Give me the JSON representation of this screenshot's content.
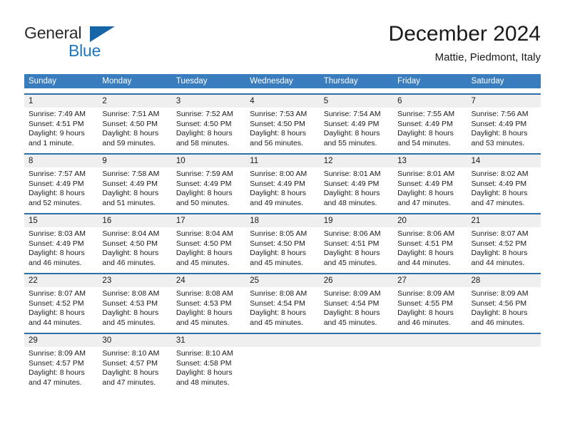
{
  "brand": {
    "line1": "General",
    "line2": "Blue",
    "triangle_color": "#1565a8",
    "blue_color": "#1f76bd"
  },
  "header": {
    "title": "December 2024",
    "subtitle": "Mattie, Piedmont, Italy"
  },
  "theme": {
    "header_row_bg": "#3a7dbf",
    "week_rule": "#2f6fa8",
    "daynum_bg": "#efefef"
  },
  "calendar": {
    "day_headers": [
      "Sunday",
      "Monday",
      "Tuesday",
      "Wednesday",
      "Thursday",
      "Friday",
      "Saturday"
    ],
    "weeks": [
      [
        {
          "day": "1",
          "sunrise": "Sunrise: 7:49 AM",
          "sunset": "Sunset: 4:51 PM",
          "daylight1": "Daylight: 9 hours",
          "daylight2": "and 1 minute."
        },
        {
          "day": "2",
          "sunrise": "Sunrise: 7:51 AM",
          "sunset": "Sunset: 4:50 PM",
          "daylight1": "Daylight: 8 hours",
          "daylight2": "and 59 minutes."
        },
        {
          "day": "3",
          "sunrise": "Sunrise: 7:52 AM",
          "sunset": "Sunset: 4:50 PM",
          "daylight1": "Daylight: 8 hours",
          "daylight2": "and 58 minutes."
        },
        {
          "day": "4",
          "sunrise": "Sunrise: 7:53 AM",
          "sunset": "Sunset: 4:50 PM",
          "daylight1": "Daylight: 8 hours",
          "daylight2": "and 56 minutes."
        },
        {
          "day": "5",
          "sunrise": "Sunrise: 7:54 AM",
          "sunset": "Sunset: 4:49 PM",
          "daylight1": "Daylight: 8 hours",
          "daylight2": "and 55 minutes."
        },
        {
          "day": "6",
          "sunrise": "Sunrise: 7:55 AM",
          "sunset": "Sunset: 4:49 PM",
          "daylight1": "Daylight: 8 hours",
          "daylight2": "and 54 minutes."
        },
        {
          "day": "7",
          "sunrise": "Sunrise: 7:56 AM",
          "sunset": "Sunset: 4:49 PM",
          "daylight1": "Daylight: 8 hours",
          "daylight2": "and 53 minutes."
        }
      ],
      [
        {
          "day": "8",
          "sunrise": "Sunrise: 7:57 AM",
          "sunset": "Sunset: 4:49 PM",
          "daylight1": "Daylight: 8 hours",
          "daylight2": "and 52 minutes."
        },
        {
          "day": "9",
          "sunrise": "Sunrise: 7:58 AM",
          "sunset": "Sunset: 4:49 PM",
          "daylight1": "Daylight: 8 hours",
          "daylight2": "and 51 minutes."
        },
        {
          "day": "10",
          "sunrise": "Sunrise: 7:59 AM",
          "sunset": "Sunset: 4:49 PM",
          "daylight1": "Daylight: 8 hours",
          "daylight2": "and 50 minutes."
        },
        {
          "day": "11",
          "sunrise": "Sunrise: 8:00 AM",
          "sunset": "Sunset: 4:49 PM",
          "daylight1": "Daylight: 8 hours",
          "daylight2": "and 49 minutes."
        },
        {
          "day": "12",
          "sunrise": "Sunrise: 8:01 AM",
          "sunset": "Sunset: 4:49 PM",
          "daylight1": "Daylight: 8 hours",
          "daylight2": "and 48 minutes."
        },
        {
          "day": "13",
          "sunrise": "Sunrise: 8:01 AM",
          "sunset": "Sunset: 4:49 PM",
          "daylight1": "Daylight: 8 hours",
          "daylight2": "and 47 minutes."
        },
        {
          "day": "14",
          "sunrise": "Sunrise: 8:02 AM",
          "sunset": "Sunset: 4:49 PM",
          "daylight1": "Daylight: 8 hours",
          "daylight2": "and 47 minutes."
        }
      ],
      [
        {
          "day": "15",
          "sunrise": "Sunrise: 8:03 AM",
          "sunset": "Sunset: 4:49 PM",
          "daylight1": "Daylight: 8 hours",
          "daylight2": "and 46 minutes."
        },
        {
          "day": "16",
          "sunrise": "Sunrise: 8:04 AM",
          "sunset": "Sunset: 4:50 PM",
          "daylight1": "Daylight: 8 hours",
          "daylight2": "and 46 minutes."
        },
        {
          "day": "17",
          "sunrise": "Sunrise: 8:04 AM",
          "sunset": "Sunset: 4:50 PM",
          "daylight1": "Daylight: 8 hours",
          "daylight2": "and 45 minutes."
        },
        {
          "day": "18",
          "sunrise": "Sunrise: 8:05 AM",
          "sunset": "Sunset: 4:50 PM",
          "daylight1": "Daylight: 8 hours",
          "daylight2": "and 45 minutes."
        },
        {
          "day": "19",
          "sunrise": "Sunrise: 8:06 AM",
          "sunset": "Sunset: 4:51 PM",
          "daylight1": "Daylight: 8 hours",
          "daylight2": "and 45 minutes."
        },
        {
          "day": "20",
          "sunrise": "Sunrise: 8:06 AM",
          "sunset": "Sunset: 4:51 PM",
          "daylight1": "Daylight: 8 hours",
          "daylight2": "and 44 minutes."
        },
        {
          "day": "21",
          "sunrise": "Sunrise: 8:07 AM",
          "sunset": "Sunset: 4:52 PM",
          "daylight1": "Daylight: 8 hours",
          "daylight2": "and 44 minutes."
        }
      ],
      [
        {
          "day": "22",
          "sunrise": "Sunrise: 8:07 AM",
          "sunset": "Sunset: 4:52 PM",
          "daylight1": "Daylight: 8 hours",
          "daylight2": "and 44 minutes."
        },
        {
          "day": "23",
          "sunrise": "Sunrise: 8:08 AM",
          "sunset": "Sunset: 4:53 PM",
          "daylight1": "Daylight: 8 hours",
          "daylight2": "and 45 minutes."
        },
        {
          "day": "24",
          "sunrise": "Sunrise: 8:08 AM",
          "sunset": "Sunset: 4:53 PM",
          "daylight1": "Daylight: 8 hours",
          "daylight2": "and 45 minutes."
        },
        {
          "day": "25",
          "sunrise": "Sunrise: 8:08 AM",
          "sunset": "Sunset: 4:54 PM",
          "daylight1": "Daylight: 8 hours",
          "daylight2": "and 45 minutes."
        },
        {
          "day": "26",
          "sunrise": "Sunrise: 8:09 AM",
          "sunset": "Sunset: 4:54 PM",
          "daylight1": "Daylight: 8 hours",
          "daylight2": "and 45 minutes."
        },
        {
          "day": "27",
          "sunrise": "Sunrise: 8:09 AM",
          "sunset": "Sunset: 4:55 PM",
          "daylight1": "Daylight: 8 hours",
          "daylight2": "and 46 minutes."
        },
        {
          "day": "28",
          "sunrise": "Sunrise: 8:09 AM",
          "sunset": "Sunset: 4:56 PM",
          "daylight1": "Daylight: 8 hours",
          "daylight2": "and 46 minutes."
        }
      ],
      [
        {
          "day": "29",
          "sunrise": "Sunrise: 8:09 AM",
          "sunset": "Sunset: 4:57 PM",
          "daylight1": "Daylight: 8 hours",
          "daylight2": "and 47 minutes."
        },
        {
          "day": "30",
          "sunrise": "Sunrise: 8:10 AM",
          "sunset": "Sunset: 4:57 PM",
          "daylight1": "Daylight: 8 hours",
          "daylight2": "and 47 minutes."
        },
        {
          "day": "31",
          "sunrise": "Sunrise: 8:10 AM",
          "sunset": "Sunset: 4:58 PM",
          "daylight1": "Daylight: 8 hours",
          "daylight2": "and 48 minutes."
        },
        {
          "day": "",
          "sunrise": "",
          "sunset": "",
          "daylight1": "",
          "daylight2": ""
        },
        {
          "day": "",
          "sunrise": "",
          "sunset": "",
          "daylight1": "",
          "daylight2": ""
        },
        {
          "day": "",
          "sunrise": "",
          "sunset": "",
          "daylight1": "",
          "daylight2": ""
        },
        {
          "day": "",
          "sunrise": "",
          "sunset": "",
          "daylight1": "",
          "daylight2": ""
        }
      ]
    ]
  }
}
